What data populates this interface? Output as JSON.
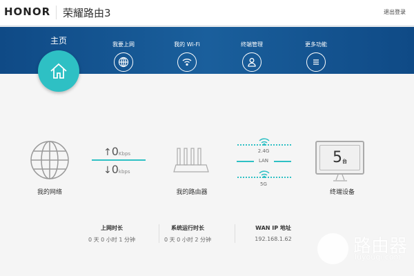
{
  "header": {
    "brand": "HONOR",
    "product": "荣耀路由3",
    "logout": "退出登录"
  },
  "nav": {
    "home": "主页",
    "tabs": [
      {
        "label": "我要上网",
        "icon": "globe-icon"
      },
      {
        "label": "我的 Wi-Fi",
        "icon": "wifi-icon"
      },
      {
        "label": "终端管理",
        "icon": "user-icon"
      },
      {
        "label": "更多功能",
        "icon": "menu-icon"
      }
    ]
  },
  "network": {
    "label": "我的网络",
    "up_value": "0",
    "up_unit": "Kbps",
    "down_value": "0",
    "down_unit": "kbps",
    "up_arrow": "↑",
    "down_arrow": "↓"
  },
  "router": {
    "label": "我的路由器"
  },
  "links": {
    "band1": "2.4G",
    "lan": "LAN",
    "band2": "5G"
  },
  "devices": {
    "count": "5",
    "unit": "台",
    "label": "终端设备"
  },
  "stats": [
    {
      "title": "上网时长",
      "value": "0 天 0 小时 1 分钟"
    },
    {
      "title": "系统运行时长",
      "value": "0 天 0 小时 2 分钟"
    },
    {
      "title": "WAN IP 地址",
      "value": "192.168.1.62"
    }
  ],
  "watermark": {
    "title": "路由器",
    "url": "luyouqi.com"
  },
  "colors": {
    "accent": "#2ec0c4",
    "nav": "#1a5f9c"
  }
}
